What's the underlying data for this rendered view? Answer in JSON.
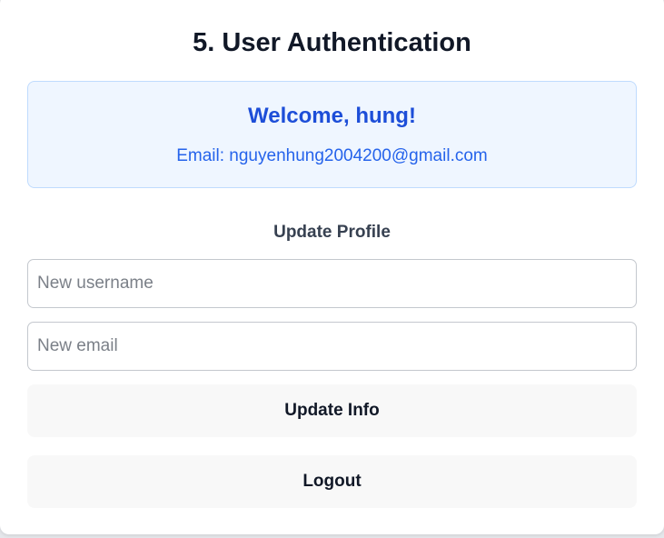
{
  "page": {
    "title": "5. User Authentication"
  },
  "welcome": {
    "greeting": "Welcome, hung!",
    "email_line": "Email: nguyenhung2004200@gmail.com"
  },
  "profile_form": {
    "section_title": "Update Profile",
    "username_placeholder": "New username",
    "username_value": "",
    "email_placeholder": "New email",
    "email_value": "",
    "update_button_label": "Update Info"
  },
  "actions": {
    "logout_button_label": "Logout"
  },
  "colors": {
    "welcome_background": "#eff6ff",
    "welcome_border": "#bfdbfe",
    "welcome_title": "#1d4ed8",
    "welcome_email": "#2563eb",
    "button_background": "#f8f8f8"
  }
}
